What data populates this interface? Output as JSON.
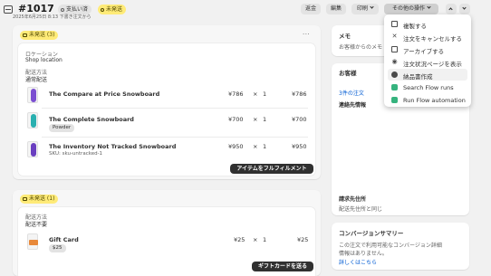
{
  "header": {
    "order_number": "#1017",
    "payment_status": "支払い済",
    "fulfillment_status": "未発送",
    "date": "2025年6月25日 8:13 下書き注文から",
    "btn_refund": "返金",
    "btn_edit": "編集",
    "btn_print": "印刷",
    "btn_more": "その他の操作"
  },
  "fulfillment_1": {
    "badge": "未発送 (3)",
    "location_label": "ロケーション",
    "location_value": "Shop location",
    "delivery_label": "配送方法",
    "delivery_value": "通常配送",
    "items": [
      {
        "name": "The Compare at Price Snowboard",
        "price": "¥786",
        "times": "×",
        "qty": "1",
        "total": "¥786",
        "color": "#7b4fd1"
      },
      {
        "name": "The Complete Snowboard",
        "tag": "Powder",
        "price": "¥700",
        "times": "×",
        "qty": "1",
        "total": "¥700",
        "color": "#2ab0b0"
      },
      {
        "name": "The Inventory Not Tracked Snowboard",
        "sku": "SKU: sku-untracked-1",
        "price": "¥950",
        "times": "×",
        "qty": "1",
        "total": "¥950",
        "color": "#6a3fc0"
      }
    ],
    "action_button": "アイテムをフルフィルメント"
  },
  "fulfillment_2": {
    "badge": "未発送 (1)",
    "delivery_label": "配送方法",
    "delivery_value": "配送不要",
    "items": [
      {
        "name": "Gift Card",
        "tag": "$25",
        "price": "¥25",
        "times": "×",
        "qty": "1",
        "total": "¥25",
        "color": "#e8893a"
      }
    ],
    "action_button": "ギフトカードを送る"
  },
  "sidebar": {
    "notes_title": "メモ",
    "notes_text": "お客様からのメモ",
    "customer_title": "お客様",
    "orders_link": "3件の注文",
    "contact_title": "連絡先情報",
    "billing_title": "請求先住所",
    "billing_text": "配送先住所と同じ",
    "conversion_title": "コンバージョンサマリー",
    "conversion_text_1": "この注文で利用可能なコンバージョン詳細",
    "conversion_text_2": "情報はありません。",
    "conversion_link": "詳しくはこちら"
  },
  "more_menu": [
    {
      "label": "複製する",
      "icon": "duplicate-icon"
    },
    {
      "label": "注文をキャンセルする",
      "icon": "close-icon"
    },
    {
      "label": "アーカイブする",
      "icon": "archive-icon"
    },
    {
      "label": "注文状況ページを表示",
      "icon": "eye-icon"
    },
    {
      "label": "納品書作成",
      "icon": "package-icon",
      "active": true
    },
    {
      "label": "Search Flow runs",
      "icon": "flow-app-icon"
    },
    {
      "label": "Run Flow automation",
      "icon": "flow-app-icon"
    }
  ]
}
